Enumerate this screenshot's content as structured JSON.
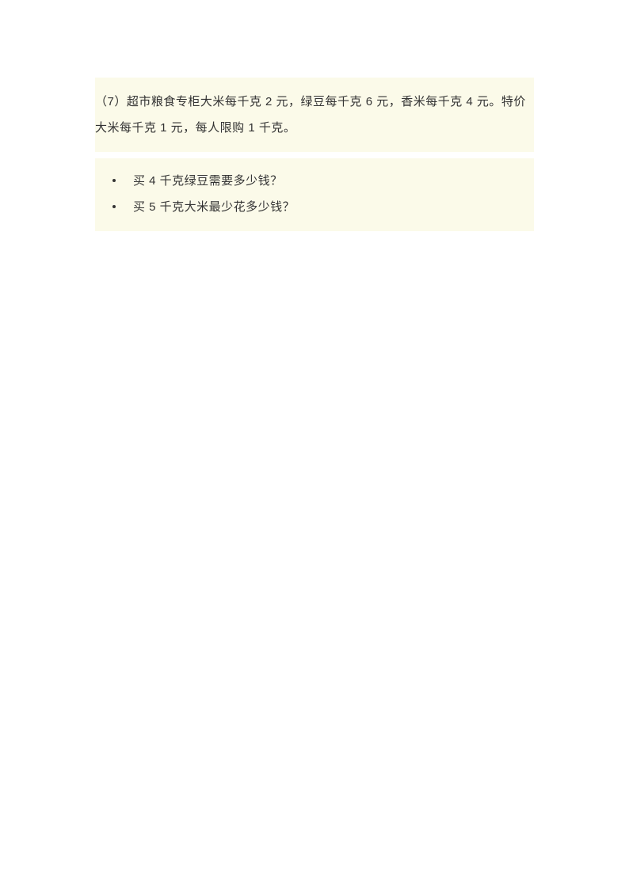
{
  "problem": {
    "statement": "（7）超市粮食专柜大米每千克 2 元，绿豆每千克 6 元，香米每千克 4 元。特价大米每千克 1 元，每人限购 1 千克。"
  },
  "questions": {
    "items": [
      "买 4 千克绿豆需要多少钱？",
      "买 5 千克大米最少花多少钱？"
    ]
  }
}
